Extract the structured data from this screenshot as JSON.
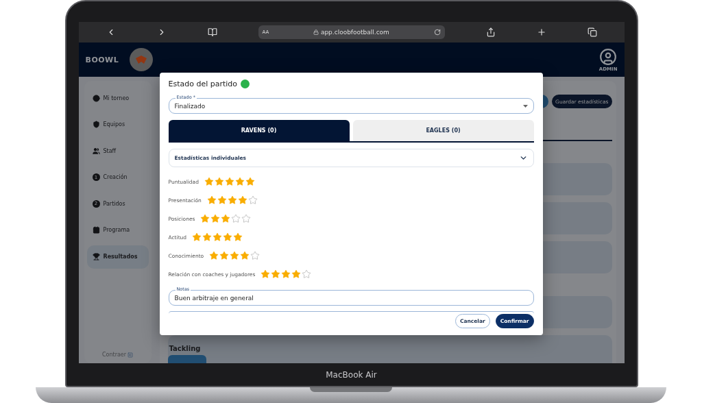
{
  "device": {
    "label": "MacBook Air"
  },
  "browser": {
    "text_size": "AA",
    "url": "app.cloobfootball.com"
  },
  "header": {
    "logo": "BOOWL",
    "user": "ADMIN"
  },
  "sidebar": {
    "items": [
      {
        "label": "Mi torneo",
        "kind": "icon",
        "selected": false
      },
      {
        "label": "Equipos",
        "kind": "icon",
        "selected": false
      },
      {
        "label": "Staff",
        "kind": "icon",
        "selected": false
      },
      {
        "label": "Creación",
        "kind": "number",
        "badge": "1",
        "selected": false
      },
      {
        "label": "Partidos",
        "kind": "number",
        "badge": "2",
        "selected": false
      },
      {
        "label": "Programa",
        "kind": "icon",
        "selected": false
      },
      {
        "label": "Resultados",
        "kind": "icon",
        "selected": true
      }
    ],
    "collapse": "Contraer"
  },
  "main": {
    "save_button": "Guardar estadísticas",
    "section": "Tackling"
  },
  "modal": {
    "title": "Estado del partido",
    "status_ok": true,
    "estado": {
      "label": "Estado *",
      "value": "Finalizado"
    },
    "tabs": [
      {
        "label": "RAVENS (0)",
        "selected": true
      },
      {
        "label": "EAGLES (0)",
        "selected": false
      }
    ],
    "accordion": {
      "title": "Estadísticas individuales",
      "expanded": true
    },
    "ratings": [
      {
        "label": "Puntualidad",
        "stars": 5
      },
      {
        "label": "Presentación",
        "stars": 4
      },
      {
        "label": "Posiciones",
        "stars": 3
      },
      {
        "label": "Actitud",
        "stars": 5
      },
      {
        "label": "Conocimiento",
        "stars": 4
      },
      {
        "label": "Relación con coaches y jugadores",
        "stars": 4
      }
    ],
    "notes": {
      "label": "Notas",
      "value": "Buen arbitraje en general"
    },
    "buttons": [
      {
        "label": "Cancelar",
        "kind": "secondary"
      },
      {
        "label": "Confirmar",
        "kind": "primary"
      }
    ]
  }
}
